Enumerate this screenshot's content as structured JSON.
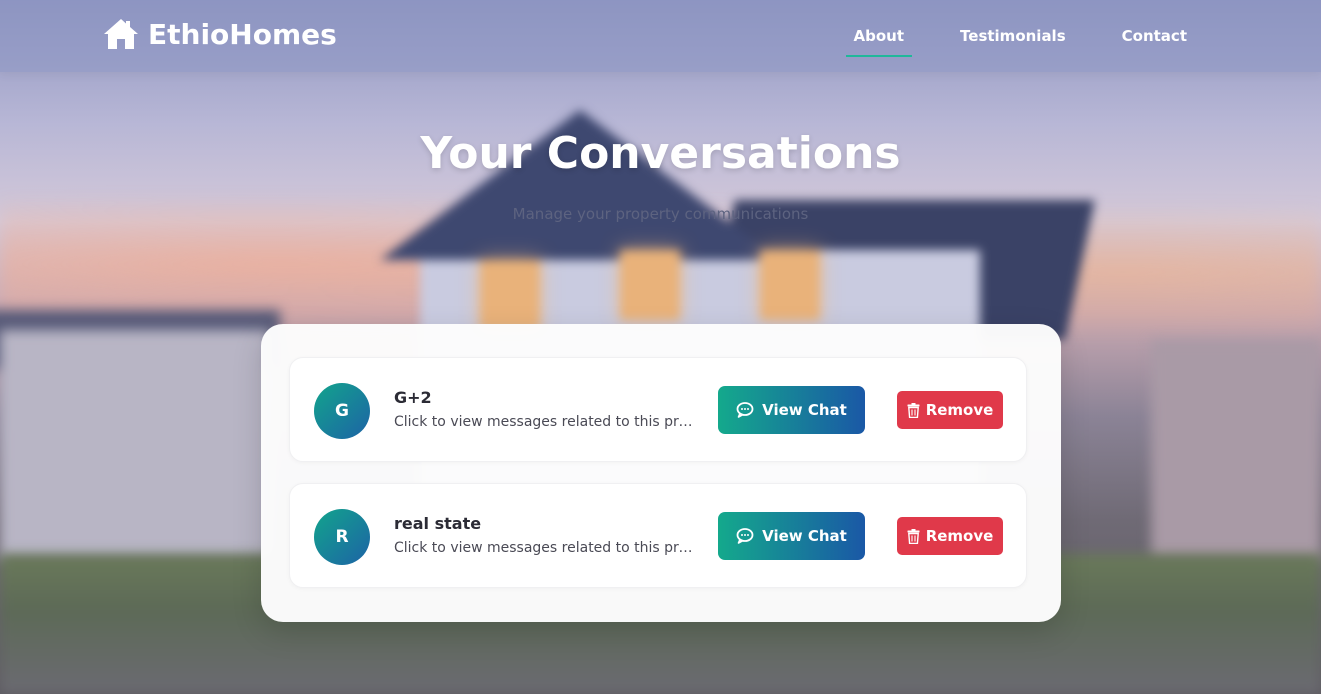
{
  "brand": {
    "name": "EthioHomes",
    "icon": "home-icon"
  },
  "nav": {
    "items": [
      {
        "label": "About",
        "active": true
      },
      {
        "label": "Testimonials",
        "active": false
      },
      {
        "label": "Contact",
        "active": false
      }
    ]
  },
  "hero": {
    "title": "Your Conversations",
    "subtitle": "Manage your property communications"
  },
  "conversations": [
    {
      "initial": "G",
      "name": "G+2",
      "preview": "Click to view messages related to this property",
      "view_label": "View Chat",
      "remove_label": "Remove"
    },
    {
      "initial": "R",
      "name": "real state",
      "preview": "Click to view messages related to this property",
      "view_label": "View Chat",
      "remove_label": "Remove"
    }
  ],
  "colors": {
    "accent": "#1fb89a",
    "gradient_start": "#14a98c",
    "gradient_end": "#1a58a6",
    "danger": "#e0394a"
  },
  "icons": {
    "view": "chat-bubble-icon",
    "remove": "trash-icon"
  }
}
